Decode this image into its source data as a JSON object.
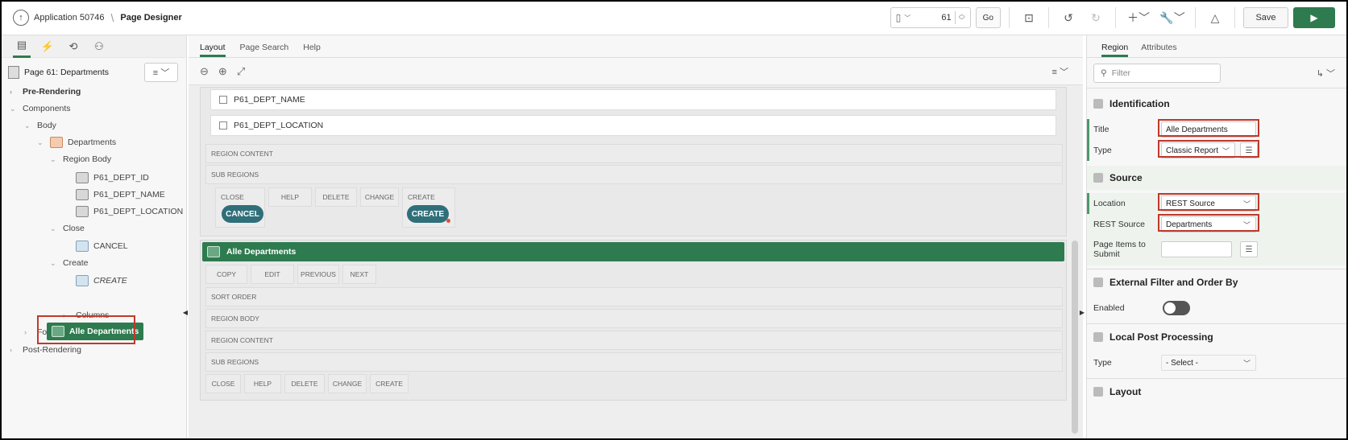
{
  "header": {
    "app_label": "Application 50746",
    "page_designer": "Page Designer",
    "page_number": "61",
    "go_label": "Go",
    "save_label": "Save"
  },
  "left_panel": {
    "page_title": "Page 61: Departments",
    "tree": {
      "pre_rendering": "Pre-Rendering",
      "components": "Components",
      "body": "Body",
      "departments": "Departments",
      "region_body": "Region Body",
      "dept_id": "P61_DEPT_ID",
      "dept_name": "P61_DEPT_NAME",
      "dept_location": "P61_DEPT_LOCATION",
      "close": "Close",
      "cancel": "CANCEL",
      "create": "Create",
      "create_btn": "CREATE",
      "alle_departments": "Alle Departments",
      "columns": "Columns",
      "footer": "Footer",
      "post_rendering": "Post-Rendering"
    }
  },
  "middle": {
    "tabs": [
      "Layout",
      "Page Search",
      "Help"
    ],
    "region1": {
      "items": [
        "P61_DEPT_NAME",
        "P61_DEPT_LOCATION"
      ],
      "region_content": "REGION CONTENT",
      "sub_regions": "SUB REGIONS",
      "buttons": [
        "CLOSE",
        "HELP",
        "DELETE",
        "CHANGE",
        "CREATE"
      ],
      "cancel_pill": "CANCEL",
      "create_pill": "CREATE"
    },
    "region2": {
      "title": "Alle Departments",
      "top_buttons": [
        "COPY",
        "EDIT",
        "PREVIOUS",
        "NEXT"
      ],
      "sort_order": "SORT ORDER",
      "region_body": "REGION BODY",
      "region_content": "REGION CONTENT",
      "sub_regions": "SUB REGIONS",
      "bottom_buttons": [
        "CLOSE",
        "HELP",
        "DELETE",
        "CHANGE",
        "CREATE"
      ]
    }
  },
  "right_panel": {
    "tabs": [
      "Region",
      "Attributes"
    ],
    "filter_placeholder": "Filter",
    "identification": {
      "heading": "Identification",
      "title_label": "Title",
      "title_value": "Alle Departments",
      "type_label": "Type",
      "type_value": "Classic Report"
    },
    "source": {
      "heading": "Source",
      "location_label": "Location",
      "location_value": "REST Source",
      "rest_source_label": "REST Source",
      "rest_source_value": "Departments",
      "page_items_label_1": "Page Items to",
      "page_items_label_2": "Submit"
    },
    "external_filter": {
      "heading": "External Filter and Order By",
      "enabled_label": "Enabled"
    },
    "local_post": {
      "heading": "Local Post Processing",
      "type_label": "Type",
      "type_value": "- Select -"
    },
    "layout": {
      "heading": "Layout"
    }
  }
}
